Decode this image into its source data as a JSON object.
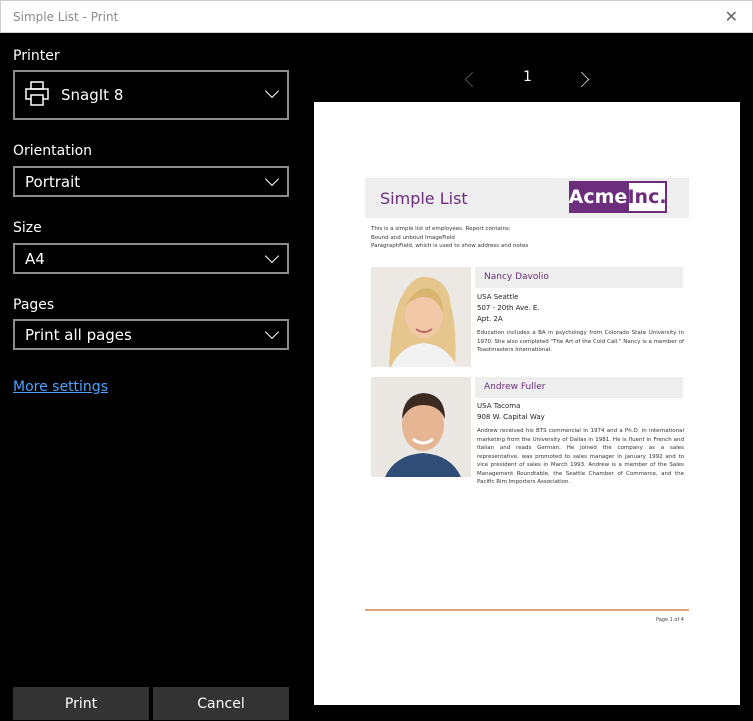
{
  "window": {
    "title": "Simple List - Print",
    "close_glyph": "✕"
  },
  "settings": {
    "printer": {
      "label": "Printer",
      "value": "SnagIt 8",
      "icon": "printer-icon"
    },
    "orientation": {
      "label": "Orientation",
      "value": "Portrait"
    },
    "size": {
      "label": "Size",
      "value": "A4"
    },
    "pages": {
      "label": "Pages",
      "value": "Print all pages"
    },
    "more_settings": "More settings"
  },
  "buttons": {
    "print": "Print",
    "cancel": "Cancel"
  },
  "pager": {
    "current": "1"
  },
  "preview": {
    "report_title": "Simple List",
    "logo": {
      "part1": "Acme",
      "part2": "Inc."
    },
    "intro": [
      "This is a simple list of employees. Report contains:",
      "Bound and unboud ImageField",
      "ParagraphField, which is used to show address and notes"
    ],
    "employees": [
      {
        "name": "Nancy Davolio",
        "address": [
          "USA Seattle",
          "507 - 20th Ave. E.",
          "Apt. 2A"
        ],
        "notes": "Education includes a BA in psychology from Colorado State University in 1970. She also completed \"The Art of the Cold Call.\" Nancy is a member of Toastmasters International."
      },
      {
        "name": "Andrew Fuller",
        "address": [
          "USA Tacoma",
          "908 W. Capital Way"
        ],
        "notes": "Andrew received his BTS commercial in 1974 and a Ph.D. in international marketing from the University of Dallas in 1981. He is fluent in French and Italian and reads German. He joined the company as a sales representative, was promoted to sales manager in January 1992 and to vice president of sales in March 1993. Andrew is a member of the Sales Management Roundtable, the Seattle Chamber of Commerce, and the Pacific Rim Importers Association."
      }
    ],
    "footer": "Page 1 of 4"
  },
  "colors": {
    "accent": "#6b2d7c",
    "link": "#4aa3ff",
    "footer_rule": "#e0a37f",
    "button_bg": "#333333"
  }
}
